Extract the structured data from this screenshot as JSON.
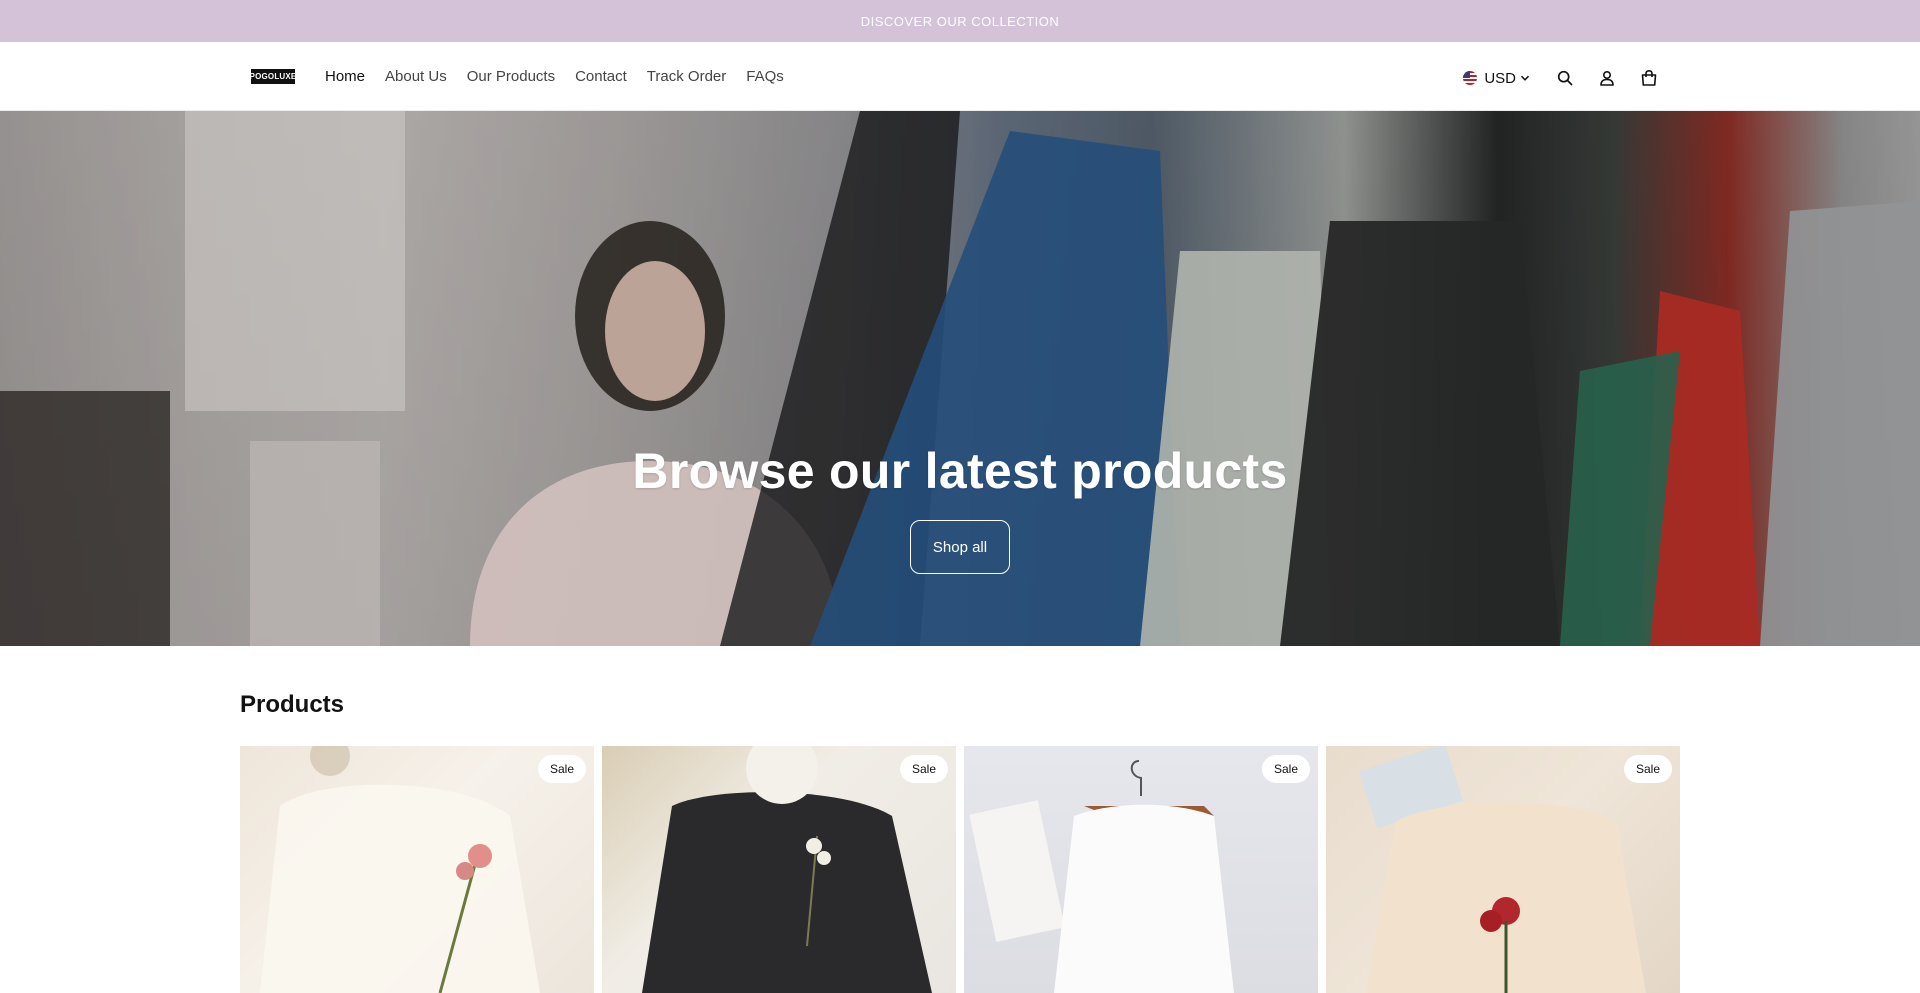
{
  "announcement": {
    "text": "DISCOVER OUR COLLECTION"
  },
  "header": {
    "logo_text": "POGOLUXE",
    "nav": [
      {
        "label": "Home",
        "active": true
      },
      {
        "label": "About Us"
      },
      {
        "label": "Our Products"
      },
      {
        "label": "Contact"
      },
      {
        "label": "Track Order"
      },
      {
        "label": "FAQs"
      }
    ],
    "currency": "USD",
    "icons": [
      "us-flag-icon",
      "chevron-down-icon",
      "search-icon",
      "account-icon",
      "cart-icon"
    ]
  },
  "hero": {
    "title": "Browse our latest products",
    "button_label": "Shop all"
  },
  "products": {
    "title": "Products",
    "items": [
      {
        "badge": "Sale"
      },
      {
        "badge": "Sale"
      },
      {
        "badge": "Sale"
      },
      {
        "badge": "Sale"
      }
    ]
  },
  "colors": {
    "announcement_bg": "#d4c2d8",
    "text": "#121212"
  }
}
